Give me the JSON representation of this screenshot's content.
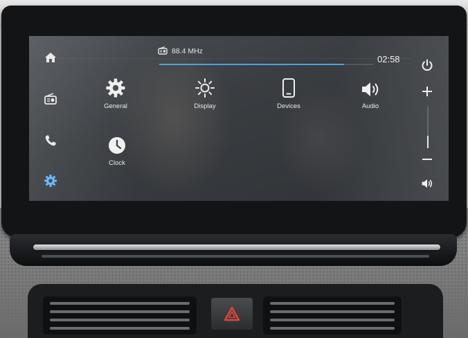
{
  "status_bar": {
    "source_icon": "radio-icon",
    "frequency": "88.4 MHz",
    "clock": "02:58",
    "track_progress": 0.86
  },
  "left_nav": [
    {
      "icon": "home-icon"
    },
    {
      "icon": "radio-icon"
    },
    {
      "icon": "phone-icon"
    },
    {
      "icon": "gear-icon",
      "active": true
    }
  ],
  "settings_tiles": [
    {
      "icon": "gear-icon",
      "label": "General"
    },
    {
      "icon": "brightness-icon",
      "label": "Display"
    },
    {
      "icon": "smartphone-icon",
      "label": "Devices"
    },
    {
      "icon": "speaker-icon",
      "label": "Audio"
    },
    {
      "icon": "clock-icon",
      "label": "Clock"
    }
  ],
  "right_controls": {
    "power_icon": "power-icon",
    "volume_up_icon": "plus-icon",
    "volume_down_icon": "minus-icon",
    "mute_icon": "speaker-icon",
    "volume_level": 0.3
  },
  "colors": {
    "accent": "#4aa3df",
    "active_nav": "#5fb6ff",
    "text": "#ececec"
  }
}
